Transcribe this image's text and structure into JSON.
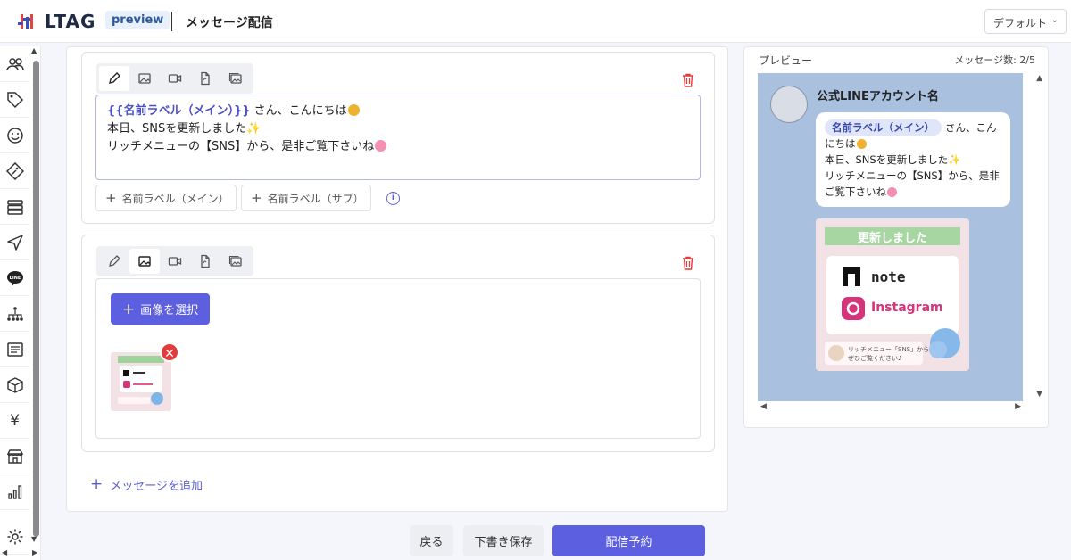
{
  "header": {
    "logo_text": "LTAG",
    "badge": "preview",
    "title": "メッセージ配信",
    "default_select": "デフォルト"
  },
  "sidebar": {
    "items": [
      "users-icon",
      "tag-icon",
      "smile-icon",
      "diamond-tag-icon",
      "server-icon",
      "send-icon",
      "line-icon",
      "sitemap-icon",
      "list-icon",
      "box-icon",
      "yen-icon",
      "store-icon",
      "bar-chart-icon",
      "gear-icon"
    ],
    "yen_glyph": "¥"
  },
  "editor": {
    "text_message": {
      "var_tag": "{{名前ラベル（メイン）}}",
      "line1_rest": "さん、こんにちは",
      "line2": "本日、SNSを更新しました",
      "line3": "リッチメニューの【SNS】から、是非ご覧下さいね",
      "label_main": "名前ラベル（メイン）",
      "label_sub": "名前ラベル（サブ）",
      "info": "i"
    },
    "image_message": {
      "select_image": "画像を選択",
      "remove": "✕"
    },
    "add_message": "メッセージを追加"
  },
  "footer": {
    "back": "戻る",
    "draft": "下書き保存",
    "schedule": "配信予約"
  },
  "preview": {
    "label": "プレビュー",
    "count": "メッセージ数: 2/5",
    "account_name": "公式LINEアカウント名",
    "chip": "名前ラベル（メイン）",
    "line1_rest": "さん、こんにちは",
    "line2": "本日、SNSを更新しました",
    "line3": "リッチメニューの【SNS】から、是非ご覧下さいね",
    "image": {
      "banner": "更新しました",
      "note": "note",
      "instagram": "Instagram",
      "caption1": "リッチメニュー「SNS」から",
      "caption2": "ぜひご覧ください♪"
    }
  },
  "colors": {
    "accent": "#5b5fe0",
    "danger": "#e23b3b",
    "preview_bg": "#a9c0de"
  }
}
